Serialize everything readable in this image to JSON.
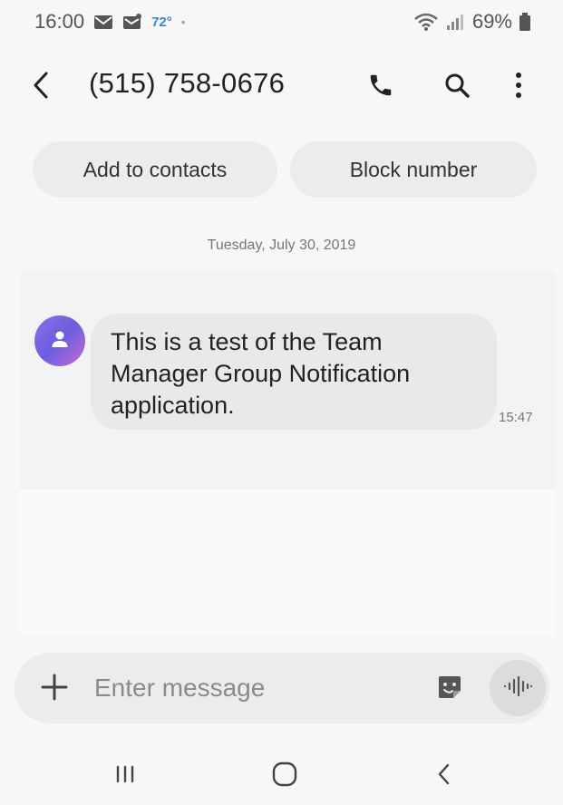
{
  "status_bar": {
    "time": "16:00",
    "weather": "72°",
    "battery": "69%",
    "icons": [
      "mail-icon",
      "message-icon",
      "weather-icon",
      "wifi-icon",
      "signal-icon",
      "battery-icon"
    ]
  },
  "header": {
    "title": "(515) 758-0676",
    "icons": [
      "back-arrow-icon",
      "phone-icon",
      "search-icon",
      "more-vert-icon"
    ]
  },
  "actions": {
    "add_to_contacts": "Add to contacts",
    "block_number": "Block number"
  },
  "conversation": {
    "date": "Tuesday, July 30, 2019",
    "messages": [
      {
        "lines": [
          "This is a test of the Team",
          "Manager Group Notification",
          "application."
        ],
        "time": "15:47"
      }
    ]
  },
  "composer": {
    "placeholder": "Enter message",
    "value": "",
    "icons": [
      "plus-icon",
      "sticker-icon",
      "voice-icon"
    ]
  },
  "nav": {
    "icons": [
      "recents-icon",
      "home-icon",
      "back-icon"
    ]
  },
  "colors": {
    "background": "#f7f7f7",
    "chip": "#ececec",
    "bubble": "#e9e9e9",
    "avatar_gradient": [
      "#8f6fe8",
      "#c86bd6"
    ],
    "weather_text": "#3a86c8"
  }
}
